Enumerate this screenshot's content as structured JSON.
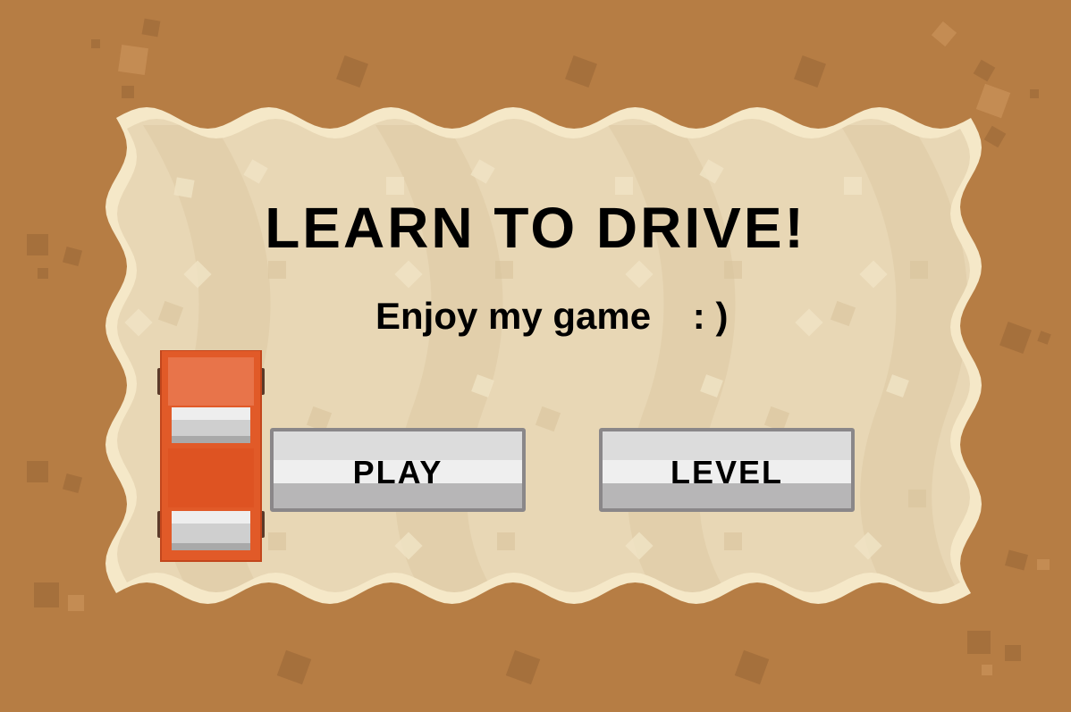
{
  "game": {
    "title": "LEARN TO DRIVE!",
    "subtitle": "Enjoy my game    : )",
    "play_label": "PLAY",
    "level_label": "LEVEL"
  },
  "colors": {
    "background": "#b67d44",
    "panel": "#e8d7b5",
    "panel_border": "#f5e8c8",
    "car_body": "#e15a28",
    "button_face": "#dcdcdc",
    "button_border": "#8a8789"
  },
  "sprites": {
    "car": "car-top-view-icon"
  }
}
